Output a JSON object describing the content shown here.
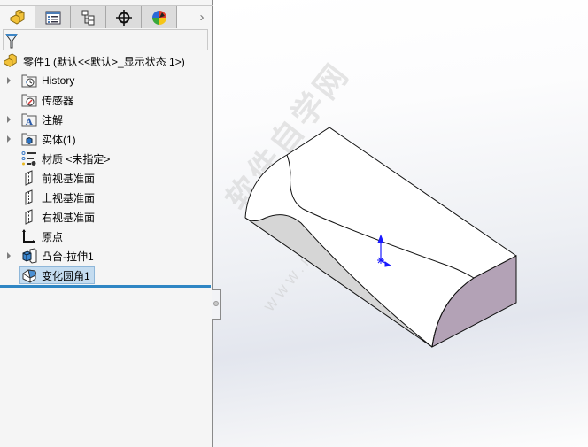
{
  "tabs": [
    {
      "name": "feature-manager",
      "icon": "part-icon"
    },
    {
      "name": "property-manager",
      "icon": "property-list-icon"
    },
    {
      "name": "configuration-manager",
      "icon": "configuration-tree-icon"
    },
    {
      "name": "dimxpert-manager",
      "icon": "crosshair-icon"
    },
    {
      "name": "display-manager",
      "icon": "color-wheel-icon"
    }
  ],
  "tab_more": "›",
  "filter": {
    "icon": "filter-icon",
    "value": ""
  },
  "tree": {
    "root": "零件1  (默认<<默认>_显示状态 1>)",
    "items": [
      {
        "label": "History",
        "icon": "history-folder-icon",
        "expandable": true
      },
      {
        "label": "传感器",
        "icon": "sensors-folder-icon",
        "expandable": false
      },
      {
        "label": "注解",
        "icon": "annotations-folder-icon",
        "expandable": true
      },
      {
        "label": "实体(1)",
        "icon": "solid-bodies-folder-icon",
        "expandable": true
      },
      {
        "label": "材质 <未指定>",
        "icon": "material-icon",
        "expandable": false
      },
      {
        "label": "前视基准面",
        "icon": "plane-icon",
        "expandable": false
      },
      {
        "label": "上视基准面",
        "icon": "plane-icon",
        "expandable": false
      },
      {
        "label": "右视基准面",
        "icon": "plane-icon",
        "expandable": false
      },
      {
        "label": "原点",
        "icon": "origin-icon",
        "expandable": false
      },
      {
        "label": "凸台-拉伸1",
        "icon": "extrude-icon",
        "expandable": true
      },
      {
        "label": "变化圆角1",
        "icon": "variable-fillet-icon",
        "expandable": false,
        "selected": true
      }
    ]
  },
  "viewport": {
    "watermark_cn": "软件自学网",
    "watermark_url": "WWW.RJZXW.COM",
    "colors": {
      "end_face": "#b3a2b6",
      "side_face": "#d8d8d8",
      "triad": "#1a1aff"
    }
  }
}
